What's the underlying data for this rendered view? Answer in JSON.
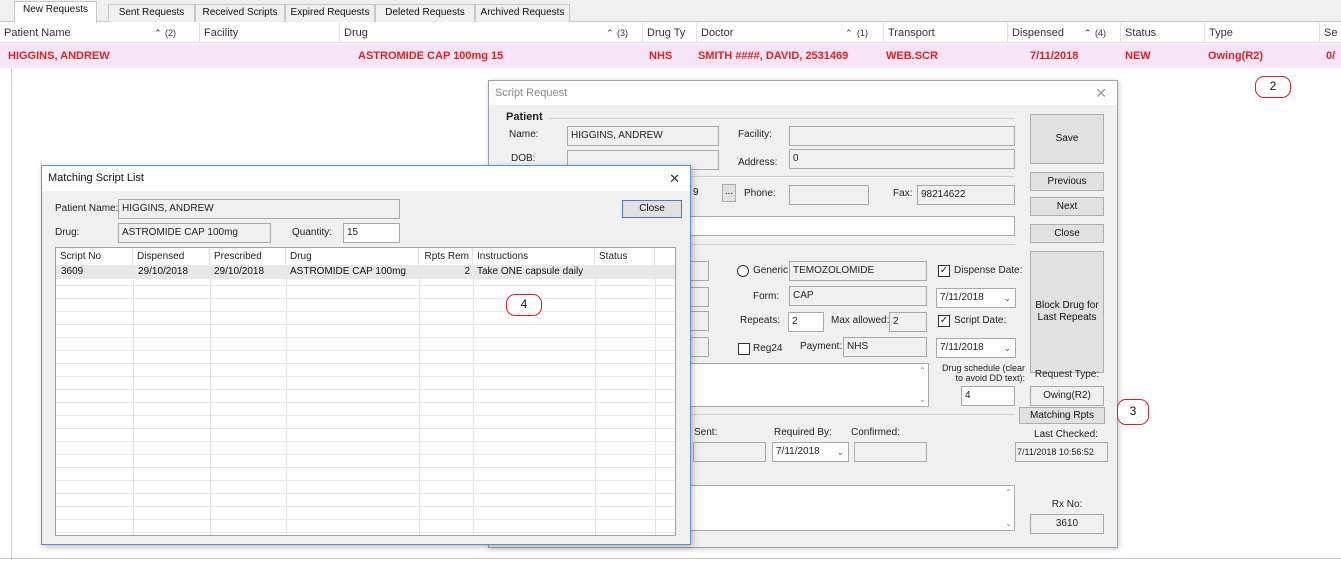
{
  "tabs": [
    "New Requests",
    "Sent Requests",
    "Received Scripts",
    "Expired Requests",
    "Deleted Requests",
    "Archived Requests"
  ],
  "grid": {
    "columns": {
      "patient_name": "Patient Name",
      "patient_sort": "(2)",
      "facility": "Facility",
      "drug": "Drug",
      "drug_sort": "(3)",
      "drug_type": "Drug Ty",
      "doctor": "Doctor",
      "doctor_sort": "(1)",
      "transport": "Transport",
      "dispensed": "Dispensed",
      "dispensed_sort": "(4)",
      "status": "Status",
      "type": "Type",
      "se": "Se"
    },
    "row": {
      "patient_name": "HIGGINS, ANDREW",
      "drug": "ASTROMIDE CAP 100mg 15",
      "drug_type": "NHS",
      "doctor": "SMITH ####, DAVID, 2531469",
      "transport": "WEB.SCR",
      "dispensed": "7/11/2018",
      "status": "NEW",
      "type": "Owing(R2)",
      "se": "0/"
    },
    "row_color": "#e02424",
    "row_bg": "#f7e4f6"
  },
  "callouts": [
    "2",
    "3",
    "4"
  ],
  "script_request": {
    "title": "Script Request",
    "patient_header": "Patient",
    "name_label": "Name:",
    "name_value": "HIGGINS, ANDREW",
    "facility_label": "Facility:",
    "dob_label": "DOB:",
    "address_label": "Address:",
    "address_value": "0",
    "partial_code": "9",
    "ellipsis": "...",
    "phone_label": "Phone:",
    "fax_label": "Fax:",
    "fax_value": "98214622",
    "generic_label": "Generic:",
    "generic_value": "TEMOZOLOMIDE",
    "form_label": "Form:",
    "form_value": "CAP",
    "repeats_label": "Repeats:",
    "repeats_value": "2",
    "max_allowed_label": "Max allowed:",
    "max_allowed_value": "2",
    "reg24_label": "Reg24",
    "payment_label": "Payment:",
    "payment_value": "NHS",
    "dispense_date_label": "Dispense Date:",
    "dispense_date_value": "7/11/2018",
    "script_date_label": "Script Date:",
    "script_date_value": "7/11/2018",
    "drug_schedule_label": "Drug schedule (clear to avoid DD text):",
    "drug_schedule_value": "4",
    "sent_label": "Sent:",
    "required_by_label": "Required By:",
    "required_by_value": "7/11/2018",
    "confirmed_label": "Confirmed:",
    "save_label": "Save",
    "previous_label": "Previous",
    "next_label": "Next",
    "close_label": "Close",
    "block_drug_label": "Block Drug for Last Repeats",
    "request_type_label": "Request Type:",
    "request_type_value": "Owing(R2)",
    "matching_rpts_label": "Matching Rpts",
    "last_checked_label": "Last Checked:",
    "last_checked_value": "7/11/2018 10:56:52",
    "rx_no_label": "Rx No:",
    "rx_no_value": "3610"
  },
  "matching_script_list": {
    "title": "Matching Script List",
    "patient_name_label": "Patient Name:",
    "patient_name_value": "HIGGINS, ANDREW",
    "drug_label": "Drug:",
    "drug_value": "ASTROMIDE CAP 100mg",
    "quantity_label": "Quantity:",
    "quantity_value": "15",
    "close_label": "Close",
    "columns": [
      "Script No",
      "Dispensed",
      "Prescribed",
      "Drug",
      "Rpts Rem",
      "Instructions",
      "Status"
    ],
    "rows": [
      {
        "script_no": "3609",
        "dispensed": "29/10/2018",
        "prescribed": "29/10/2018",
        "drug": "ASTROMIDE CAP 100mg",
        "rpts_rem": "2",
        "instructions": "Take ONE capsule daily",
        "status": ""
      }
    ]
  }
}
